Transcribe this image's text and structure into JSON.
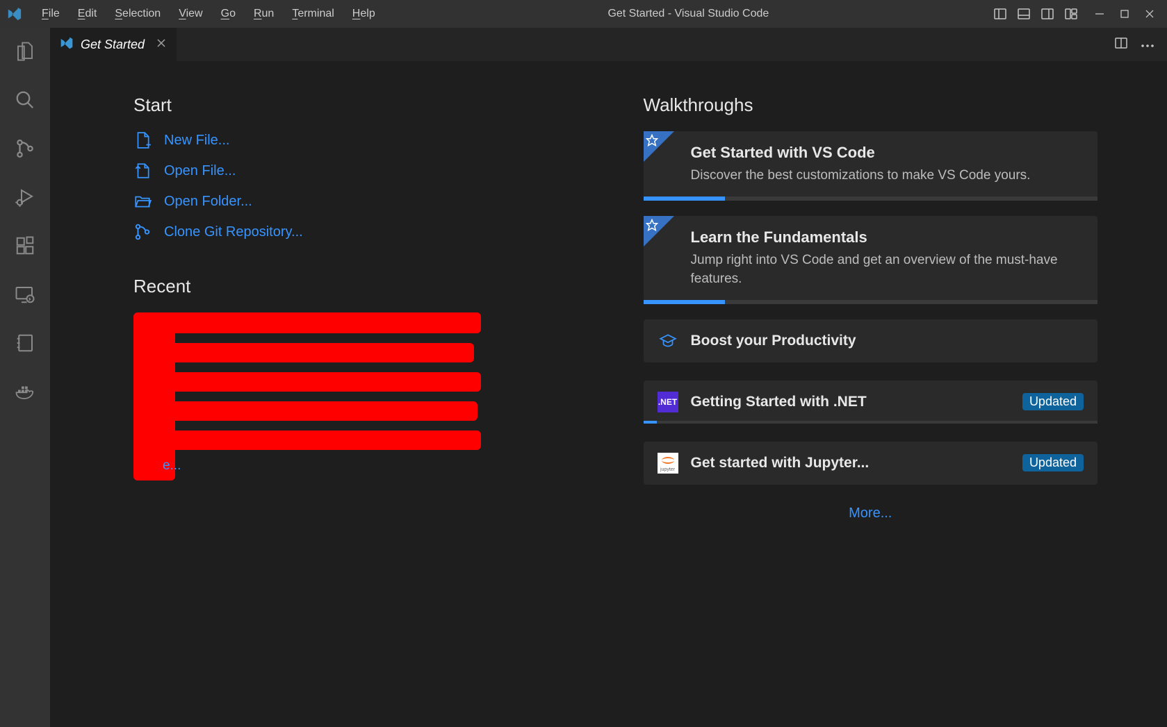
{
  "titlebar": {
    "menu": {
      "file": "File",
      "edit": "Edit",
      "selection": "Selection",
      "view": "View",
      "go": "Go",
      "run": "Run",
      "terminal": "Terminal",
      "help": "Help"
    },
    "title": "Get Started - Visual Studio Code"
  },
  "tab": {
    "label": "Get Started"
  },
  "start": {
    "heading": "Start",
    "new_file": "New File...",
    "open_file": "Open File...",
    "open_folder": "Open Folder...",
    "clone_repo": "Clone Git Repository..."
  },
  "recent": {
    "heading": "Recent",
    "more_suffix": "e..."
  },
  "walkthroughs": {
    "heading": "Walkthroughs",
    "cards": [
      {
        "title": "Get Started with VS Code",
        "desc": "Discover the best customizations to make VS Code yours.",
        "progress_pct": 18
      },
      {
        "title": "Learn the Fundamentals",
        "desc": "Jump right into VS Code and get an overview of the must-have features.",
        "progress_pct": 18
      }
    ],
    "boost": "Boost your Productivity",
    "dotnet": {
      "title": "Getting Started with .NET",
      "badge": "Updated",
      "icon_text": ".NET",
      "progress_pct": 3
    },
    "jupyter": {
      "title": "Get started with Jupyter...",
      "badge": "Updated",
      "icon_text": "jupyter"
    },
    "more": "More..."
  }
}
